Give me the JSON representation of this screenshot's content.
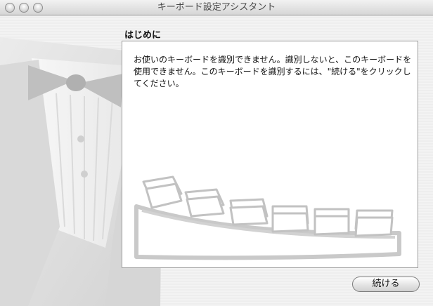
{
  "window": {
    "title": "キーボード設定アシスタント"
  },
  "main": {
    "heading": "はじめに",
    "body": "お使いのキーボードを識別できません。識別しないと、このキーボードを使用できません。このキーボードを識別するには、\"続ける\"をクリックしてください。"
  },
  "buttons": {
    "continue_label": "続ける"
  },
  "icons": {
    "close": "close-icon",
    "minimize": "minimize-icon",
    "zoom": "zoom-icon",
    "tuxedo": "tuxedo-illustration",
    "keyboard": "keyboard-illustration"
  }
}
